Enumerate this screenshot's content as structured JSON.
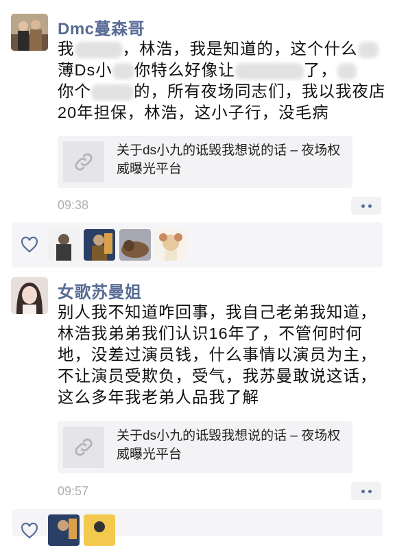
{
  "posts": [
    {
      "author": "Dmc蔓森哥",
      "lines": [
        [
          "我",
          "",
          "，林浩，我是知道的，这个什么",
          ""
        ],
        [
          "薄Ds小",
          "",
          "你特么好像让",
          "",
          "了，",
          ""
        ],
        [
          "你个",
          "",
          "的，所有夜场同志们，我以我夜店"
        ],
        [
          "20年担保，林浩，这小子行，没毛病"
        ]
      ],
      "link": {
        "title": "关于ds小九的诋毁我想说的话 – 夜场权威曝光平台"
      },
      "time": "09:38"
    },
    {
      "author": "女歌苏曼姐",
      "lines": [
        [
          "别人我不知道咋回事，我自己老弟我知道，"
        ],
        [
          "林浩我弟弟我们认识16年了，不管何时何"
        ],
        [
          "地，没差过演员钱，什么事情以演员为主，"
        ],
        [
          "不让演员受欺负，受气，我苏曼敢说这话，"
        ],
        [
          "这么多年我老弟人品我了解"
        ]
      ],
      "link": {
        "title": "关于ds小九的诋毁我想说的话 – 夜场权威曝光平台"
      },
      "time": "09:57"
    }
  ],
  "icons": {
    "link": "link-icon",
    "heart": "heart-icon",
    "more": "more-dots-icon"
  },
  "colors": {
    "name": "#576b95",
    "time": "#b0b0b0",
    "card_bg": "#f3f3f5",
    "likes_bg": "#f5f5f7"
  }
}
